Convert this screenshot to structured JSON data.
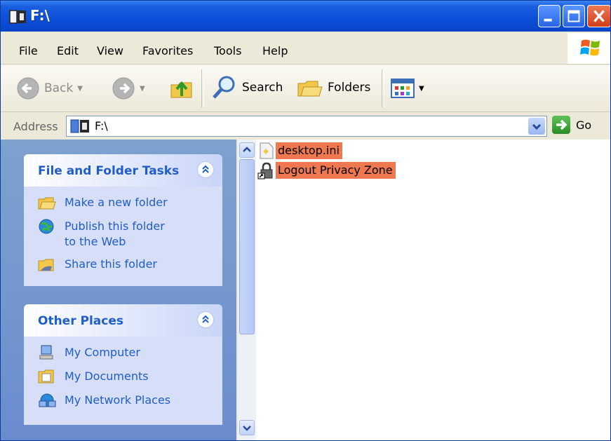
{
  "window": {
    "title": "F:\\",
    "colors": {
      "titlebar": "#0b4fd8",
      "taskpane": "#7da2ce",
      "link": "#215dc6",
      "selection": "#f07850"
    }
  },
  "menu": {
    "items": [
      "File",
      "Edit",
      "View",
      "Favorites",
      "Tools",
      "Help"
    ]
  },
  "toolbar": {
    "back_label": "Back",
    "search_label": "Search",
    "folders_label": "Folders",
    "icons": [
      "back-arrow-icon",
      "forward-arrow-icon",
      "up-folder-icon",
      "search-magnifier-icon",
      "folders-icon",
      "views-icon"
    ]
  },
  "address": {
    "label": "Address",
    "value": "F:\\",
    "go_label": "Go"
  },
  "tasks": {
    "title": "File and Folder Tasks",
    "items": [
      {
        "label": "Make a new folder",
        "icon": "new-folder-icon"
      },
      {
        "label": "Publish this folder to the Web",
        "icon": "publish-web-icon"
      },
      {
        "label": "Share this folder",
        "icon": "share-folder-icon"
      }
    ]
  },
  "places": {
    "title": "Other Places",
    "items": [
      {
        "label": "My Computer",
        "icon": "my-computer-icon"
      },
      {
        "label": "My Documents",
        "icon": "my-documents-icon"
      },
      {
        "label": "My Network Places",
        "icon": "network-places-icon"
      }
    ]
  },
  "files": [
    {
      "name": "desktop.ini",
      "icon": "ini-file-icon",
      "selected": true
    },
    {
      "name": "Logout Privacy Zone",
      "icon": "lock-shortcut-icon",
      "selected": true
    }
  ]
}
